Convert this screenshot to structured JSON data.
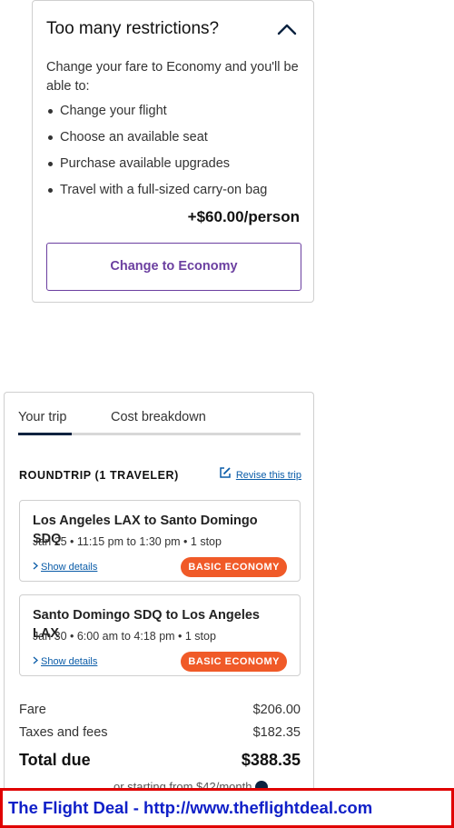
{
  "restrictions": {
    "title": "Too many restrictions?",
    "description": "Change your fare to Economy and you'll be able to:",
    "benefits": [
      "Change your flight",
      "Choose an available seat",
      "Purchase available upgrades",
      "Travel with a full-sized carry-on bag"
    ],
    "price": "+$60.00/person",
    "button_label": "Change to Economy",
    "icon": "chevron-up-icon"
  },
  "trip": {
    "tabs": [
      "Your trip",
      "Cost breakdown"
    ],
    "active_tab": "Your trip",
    "roundtrip_label": "ROUNDTRIP (1 TRAVELER)",
    "revise_label": "Revise this trip",
    "flights": [
      {
        "route": "Los Angeles LAX to Santo Domingo SDQ",
        "times": "Jan 25 • 11:15 pm to 1:30 pm • 1 stop",
        "details_label": "Show details",
        "fare_badge": "BASIC ECONOMY"
      },
      {
        "route": "Santo Domingo SDQ to Los Angeles LAX",
        "times": "Jan 30 • 6:00 am to 4:18 pm • 1 stop",
        "details_label": "Show details",
        "fare_badge": "BASIC ECONOMY"
      }
    ],
    "costs": {
      "fare_label": "Fare",
      "fare_value": "$206.00",
      "taxes_label": "Taxes and fees",
      "taxes_value": "$182.35",
      "total_label": "Total due",
      "total_value": "$388.35"
    },
    "financing_text": "or starting from $42/month"
  },
  "watermark": {
    "text": "The Flight Deal - http://www.theflightdeal.com"
  },
  "colors": {
    "accent_purple": "#6b3fa0",
    "badge_orange": "#f05a28",
    "link_blue": "#0a5ca8",
    "navy": "#0c2340",
    "watermark_red": "#e00000",
    "watermark_blue": "#1020c8"
  }
}
